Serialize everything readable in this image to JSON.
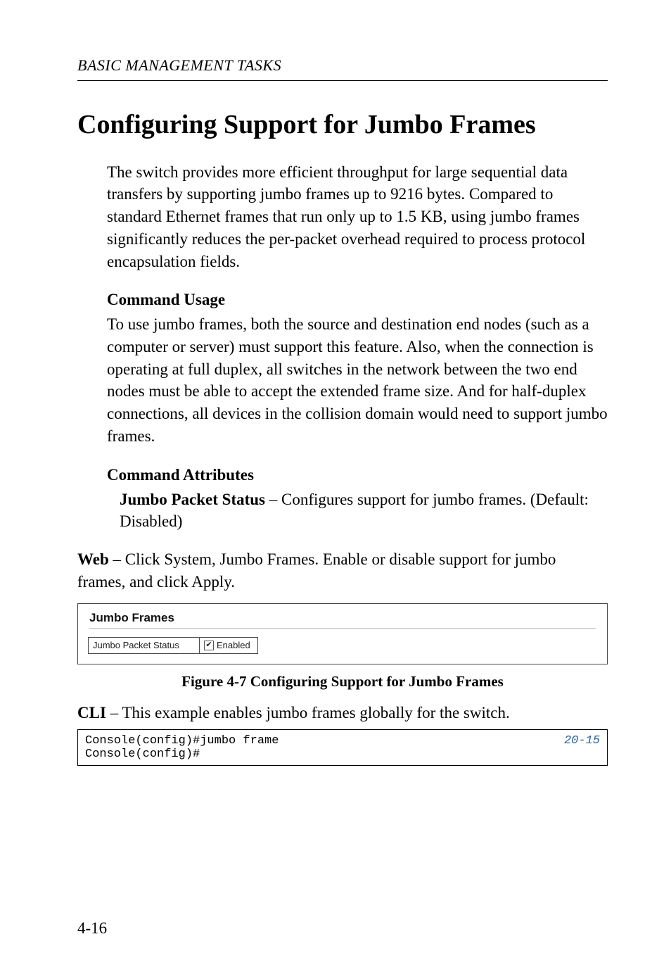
{
  "header": {
    "running_head": "BASIC MANAGEMENT TASKS"
  },
  "title": "Configuring Support for Jumbo Frames",
  "intro": "The switch provides more efficient throughput for large sequential data transfers by supporting jumbo frames up to 9216 bytes. Compared to standard Ethernet frames that run only up to 1.5 KB, using jumbo frames significantly reduces the per-packet overhead required to process protocol encapsulation fields.",
  "usage": {
    "heading": "Command Usage",
    "body": "To use jumbo frames, both the source and destination end nodes (such as a computer or server) must support this feature. Also, when the connection is operating at full duplex, all switches in the network between the two end nodes must be able to accept the extended frame size. And for half-duplex connections, all devices in the collision domain would need to support jumbo frames."
  },
  "attrs": {
    "heading": "Command Attributes",
    "item_lead": "Jumbo Packet Status",
    "item_rest": " – Configures support for jumbo frames. (Default: Disabled)"
  },
  "web": {
    "lead": "Web",
    "rest": " – Click System, Jumbo Frames. Enable or disable support for jumbo frames, and click Apply."
  },
  "figure": {
    "panel_title": "Jumbo Frames",
    "row_label": "Jumbo Packet Status",
    "checkbox_mark": "✔",
    "checkbox_label": "Enabled",
    "caption": "Figure 4-7  Configuring Support for Jumbo Frames"
  },
  "cli": {
    "lead": "CLI",
    "rest": " – This example enables jumbo frames globally for the switch."
  },
  "code": {
    "left": "Console(config)#jumbo frame\nConsole(config)#",
    "right": "20-15"
  },
  "page_number": "4-16"
}
